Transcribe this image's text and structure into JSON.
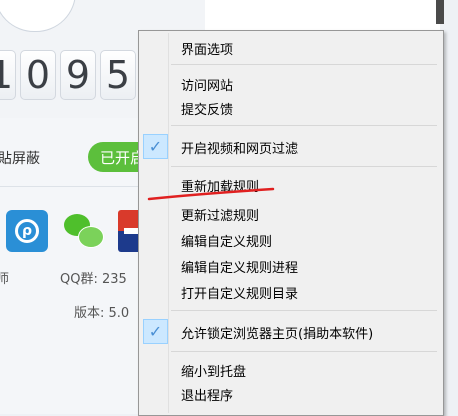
{
  "app": {
    "counter_digits": [
      "1",
      "0",
      "9",
      "5"
    ],
    "block_label": "貼屏蔽",
    "status_pill": "已开启",
    "partial_label": "师",
    "qq_group": "QQ群: 235",
    "version": "版本: 5.0"
  },
  "context_menu": {
    "items": [
      {
        "label": "界面选项",
        "checked": false
      },
      {
        "label": "访问网站",
        "checked": false
      },
      {
        "label": "提交反馈",
        "checked": false
      },
      {
        "label": "开启视频和网页过滤",
        "checked": true
      },
      {
        "label": "重新加载规则",
        "checked": false,
        "annotated": true
      },
      {
        "label": "更新过滤规则",
        "checked": false
      },
      {
        "label": "编辑自定义规则",
        "checked": false
      },
      {
        "label": "编辑自定义规则进程",
        "checked": false
      },
      {
        "label": "打开自定义规则目录",
        "checked": false
      },
      {
        "label": "允许锁定浏览器主页(捐助本软件)",
        "checked": true
      },
      {
        "label": "缩小到托盘",
        "checked": false
      },
      {
        "label": "退出程序",
        "checked": false
      }
    ],
    "check_glyph": "✓"
  },
  "colors": {
    "accent_green": "#5cbf3c",
    "check_highlight": "#cce8ff",
    "annotation_red": "#e02020"
  }
}
